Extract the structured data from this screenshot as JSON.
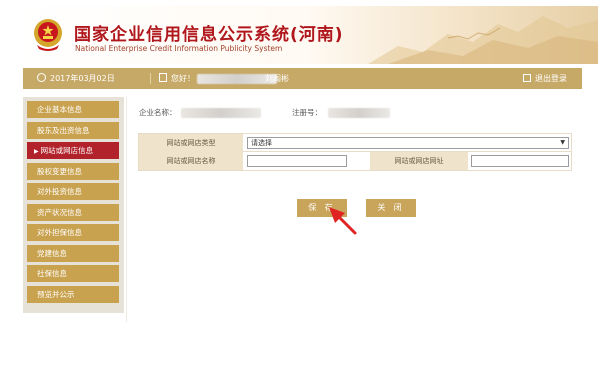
{
  "header": {
    "title_cn": "国家企业信用信息公示系统(河南)",
    "title_en": "National Enterprise Credit Information Publicity System"
  },
  "topbar": {
    "date": "2017年03月02日",
    "greeting": "您好！",
    "user_name": "刘阁彬",
    "logout": "退出登录"
  },
  "sidebar": {
    "items": [
      {
        "label": "企业基本信息",
        "active": false
      },
      {
        "label": "股东及出资信息",
        "active": false
      },
      {
        "label": "网站或网店信息",
        "active": true
      },
      {
        "label": "股权变更信息",
        "active": false
      },
      {
        "label": "对外投资信息",
        "active": false
      },
      {
        "label": "资产状况信息",
        "active": false
      },
      {
        "label": "对外担保信息",
        "active": false
      },
      {
        "label": "党建信息",
        "active": false
      },
      {
        "label": "社保信息",
        "active": false
      },
      {
        "label": "预览并公示",
        "active": false
      }
    ]
  },
  "main": {
    "company_label": "企业名称：",
    "regno_label": "注册号：",
    "form": {
      "type_label": "网站或网店类型",
      "type_value": "请选择",
      "name_label": "网站或网店名称",
      "name_value": "",
      "url_label": "网站或网店网址",
      "url_value": ""
    },
    "save_label": "保 存",
    "close_label": "关 闭"
  },
  "colors": {
    "accent": "#c9a24f",
    "active": "#b1222a",
    "title": "#b0171c"
  }
}
